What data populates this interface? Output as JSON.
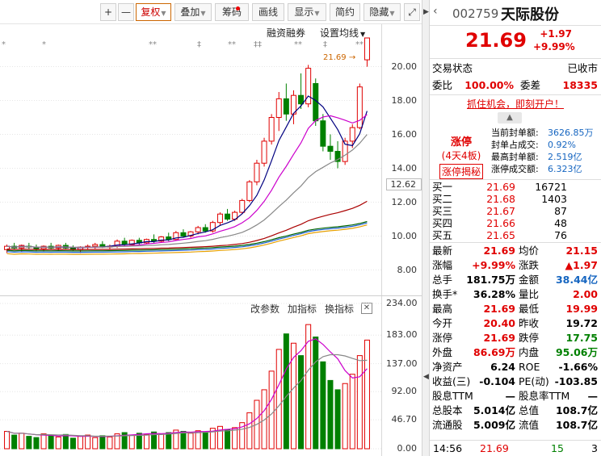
{
  "toolbar": {
    "buttons": [
      {
        "label": "+"
      },
      {
        "label": "—"
      },
      {
        "label": "复权",
        "dropdown": true,
        "active": true
      },
      {
        "label": "叠加",
        "dropdown": true
      },
      {
        "label": "筹码",
        "badge": true
      },
      {
        "label": "画线"
      },
      {
        "label": "显示",
        "dropdown": true
      },
      {
        "label": "简约"
      },
      {
        "label": "隐藏",
        "dropdown": true
      }
    ],
    "expand_icon": "expand-icon"
  },
  "price_panel": {
    "margin_label": "融资融券",
    "ma_label": "设置均线",
    "last_price_tag": "21.69",
    "current_axis_label": "12.62",
    "axis_labels": [
      "20.00",
      "18.00",
      "16.00",
      "14.00",
      "12.00",
      "10.00",
      "8.00"
    ],
    "markers": [
      "*",
      "*",
      "**",
      "‡",
      "**",
      "‡‡",
      "**",
      "‡",
      "**",
      "‡"
    ]
  },
  "volume_panel": {
    "labels": [
      "改参数",
      "加指标",
      "换指标"
    ],
    "close": "✕",
    "axis_labels": [
      "234.00",
      "183.00",
      "137.00",
      "92.00",
      "46.70",
      "0.00"
    ]
  },
  "quote": {
    "code": "002759",
    "name": "天际股份",
    "price": "21.69",
    "change": "+1.97",
    "change_pct": "+9.99%",
    "trade_status_label": "交易状态",
    "trade_status": "已收市",
    "weibi_label": "委比",
    "weibi": "100.00%",
    "weicha_label": "委差",
    "weicha": "18335",
    "promo": "抓住机会，即刻开户！",
    "limit": {
      "title": "涨停",
      "streak": "(4天4板)",
      "button": "涨停揭秘"
    },
    "seal": [
      {
        "label": "当前封单额:",
        "value": "3626.85万"
      },
      {
        "label": "封单占成交:",
        "value": "0.92%"
      },
      {
        "label": "最高封单额:",
        "value": "2.519亿"
      },
      {
        "label": "涨停成交额:",
        "value": "6.323亿"
      }
    ],
    "bids": [
      {
        "label": "买一",
        "price": "21.69",
        "vol": "16721"
      },
      {
        "label": "买二",
        "price": "21.68",
        "vol": "1403"
      },
      {
        "label": "买三",
        "price": "21.67",
        "vol": "87"
      },
      {
        "label": "买四",
        "price": "21.66",
        "vol": "48"
      },
      {
        "label": "买五",
        "price": "21.65",
        "vol": "76"
      }
    ],
    "stats": [
      {
        "l1": "最新",
        "v1": "21.69",
        "c1": "red",
        "l2": "均价",
        "v2": "21.15",
        "c2": "red"
      },
      {
        "l1": "涨幅",
        "v1": "+9.99%",
        "c1": "red",
        "l2": "涨跌",
        "v2": "▲1.97",
        "c2": "red"
      },
      {
        "l1": "总手",
        "v1": "181.75万",
        "c1": "blk",
        "l2": "金额",
        "v2": "38.44亿",
        "c2": "blue"
      },
      {
        "l1": "换手*",
        "v1": "36.28%",
        "c1": "blk",
        "l2": "量比",
        "v2": "2.00",
        "c2": "red"
      },
      {
        "l1": "最高",
        "v1": "21.69",
        "c1": "red",
        "l2": "最低",
        "v2": "19.99",
        "c2": "red"
      },
      {
        "l1": "今开",
        "v1": "20.40",
        "c1": "red",
        "l2": "昨收",
        "v2": "19.72",
        "c2": "blk"
      },
      {
        "l1": "涨停",
        "v1": "21.69",
        "c1": "red",
        "l2": "跌停",
        "v2": "17.75",
        "c2": "green"
      },
      {
        "l1": "外盘",
        "v1": "86.69万",
        "c1": "red",
        "l2": "内盘",
        "v2": "95.06万",
        "c2": "green"
      },
      {
        "l1": "净资产",
        "v1": "6.24",
        "c1": "blk",
        "l2": "ROE",
        "v2": "-1.66%",
        "c2": "blk"
      },
      {
        "l1": "收益(三)",
        "v1": "-0.104",
        "c1": "blk",
        "l2": "PE(动)",
        "v2": "-103.85",
        "c2": "blk"
      },
      {
        "l1": "股息TTM",
        "v1": "—",
        "c1": "blk",
        "l2": "股息率TTM",
        "v2": "—",
        "c2": "blk"
      },
      {
        "l1": "总股本",
        "v1": "5.014亿",
        "c1": "blk",
        "l2": "总值",
        "v2": "108.7亿",
        "c2": "blk"
      },
      {
        "l1": "流通股",
        "v1": "5.009亿",
        "c1": "blk",
        "l2": "流值",
        "v2": "108.7亿",
        "c2": "blk"
      }
    ],
    "footer": {
      "time": "14:56",
      "price": "21.69",
      "vol": "15",
      "count": "3"
    }
  },
  "chart_data": [
    {
      "type": "candlestick",
      "yticks": [
        8,
        10,
        12,
        14,
        16,
        18,
        20
      ],
      "ylim": [
        6.5,
        22.5
      ],
      "candles": [
        {
          "o": 9.2,
          "h": 9.5,
          "l": 9.0,
          "c": 9.4
        },
        {
          "o": 9.4,
          "h": 9.6,
          "l": 9.2,
          "c": 9.3
        },
        {
          "o": 9.3,
          "h": 9.5,
          "l": 9.1,
          "c": 9.45
        },
        {
          "o": 9.4,
          "h": 9.6,
          "l": 9.2,
          "c": 9.35
        },
        {
          "o": 9.35,
          "h": 9.5,
          "l": 9.1,
          "c": 9.25
        },
        {
          "o": 9.25,
          "h": 9.45,
          "l": 9.1,
          "c": 9.4
        },
        {
          "o": 9.4,
          "h": 9.6,
          "l": 9.2,
          "c": 9.3
        },
        {
          "o": 9.3,
          "h": 9.5,
          "l": 9.15,
          "c": 9.45
        },
        {
          "o": 9.45,
          "h": 9.6,
          "l": 9.2,
          "c": 9.3
        },
        {
          "o": 9.3,
          "h": 9.45,
          "l": 9.1,
          "c": 9.2
        },
        {
          "o": 9.2,
          "h": 9.4,
          "l": 9.0,
          "c": 9.35
        },
        {
          "o": 9.35,
          "h": 9.5,
          "l": 9.2,
          "c": 9.4
        },
        {
          "o": 9.4,
          "h": 9.6,
          "l": 9.25,
          "c": 9.5
        },
        {
          "o": 9.5,
          "h": 9.7,
          "l": 9.3,
          "c": 9.35
        },
        {
          "o": 9.35,
          "h": 9.5,
          "l": 9.2,
          "c": 9.4
        },
        {
          "o": 9.4,
          "h": 9.8,
          "l": 9.3,
          "c": 9.7
        },
        {
          "o": 9.7,
          "h": 9.9,
          "l": 9.4,
          "c": 9.5
        },
        {
          "o": 9.5,
          "h": 9.8,
          "l": 9.4,
          "c": 9.75
        },
        {
          "o": 9.75,
          "h": 9.9,
          "l": 9.5,
          "c": 9.6
        },
        {
          "o": 9.6,
          "h": 9.85,
          "l": 9.5,
          "c": 9.8
        },
        {
          "o": 9.8,
          "h": 10.1,
          "l": 9.6,
          "c": 9.7
        },
        {
          "o": 9.7,
          "h": 10.0,
          "l": 9.6,
          "c": 9.95
        },
        {
          "o": 9.95,
          "h": 10.2,
          "l": 9.7,
          "c": 9.8
        },
        {
          "o": 9.8,
          "h": 10.3,
          "l": 9.75,
          "c": 10.2
        },
        {
          "o": 10.2,
          "h": 10.4,
          "l": 9.9,
          "c": 10.0
        },
        {
          "o": 10.0,
          "h": 10.3,
          "l": 9.9,
          "c": 10.25
        },
        {
          "o": 10.25,
          "h": 10.6,
          "l": 10.1,
          "c": 10.5
        },
        {
          "o": 10.5,
          "h": 10.7,
          "l": 10.2,
          "c": 10.3
        },
        {
          "o": 10.3,
          "h": 10.9,
          "l": 10.2,
          "c": 10.8
        },
        {
          "o": 10.8,
          "h": 11.4,
          "l": 10.6,
          "c": 11.3
        },
        {
          "o": 11.3,
          "h": 11.6,
          "l": 10.9,
          "c": 11.0
        },
        {
          "o": 11.0,
          "h": 11.5,
          "l": 10.9,
          "c": 11.4
        },
        {
          "o": 11.4,
          "h": 12.2,
          "l": 11.3,
          "c": 12.1
        },
        {
          "o": 12.1,
          "h": 13.3,
          "l": 12.0,
          "c": 13.2
        },
        {
          "o": 13.2,
          "h": 14.5,
          "l": 13.0,
          "c": 14.3
        },
        {
          "o": 14.3,
          "h": 15.8,
          "l": 14.1,
          "c": 15.6
        },
        {
          "o": 15.6,
          "h": 17.2,
          "l": 15.4,
          "c": 17.0
        },
        {
          "o": 17.0,
          "h": 18.5,
          "l": 16.2,
          "c": 18.1
        },
        {
          "o": 18.1,
          "h": 19.0,
          "l": 16.8,
          "c": 17.2
        },
        {
          "o": 17.2,
          "h": 18.6,
          "l": 16.6,
          "c": 18.3
        },
        {
          "o": 18.3,
          "h": 19.6,
          "l": 17.5,
          "c": 17.8
        },
        {
          "o": 17.8,
          "h": 20.1,
          "l": 17.6,
          "c": 19.9
        },
        {
          "o": 19.0,
          "h": 19.3,
          "l": 16.5,
          "c": 16.8
        },
        {
          "o": 16.8,
          "h": 17.2,
          "l": 15.0,
          "c": 15.3
        },
        {
          "o": 15.3,
          "h": 16.0,
          "l": 14.5,
          "c": 15.0
        },
        {
          "o": 15.0,
          "h": 15.6,
          "l": 14.0,
          "c": 14.4
        },
        {
          "o": 14.4,
          "h": 15.8,
          "l": 14.2,
          "c": 15.6
        },
        {
          "o": 15.6,
          "h": 16.6,
          "l": 15.2,
          "c": 16.4
        },
        {
          "o": 16.4,
          "h": 19.0,
          "l": 16.3,
          "c": 18.8
        },
        {
          "o": 20.4,
          "h": 21.69,
          "l": 19.99,
          "c": 21.69
        }
      ]
    },
    {
      "type": "bar",
      "yticks": [
        0,
        46.7,
        92,
        137,
        183,
        234
      ],
      "ylim": [
        0,
        234
      ],
      "values": [
        28,
        22,
        25,
        20,
        18,
        24,
        21,
        19,
        23,
        17,
        20,
        22,
        18,
        21,
        19,
        24,
        26,
        22,
        25,
        23,
        27,
        24,
        26,
        30,
        28,
        25,
        29,
        27,
        33,
        36,
        31,
        34,
        42,
        58,
        78,
        95,
        125,
        160,
        185,
        170,
        150,
        200,
        180,
        140,
        110,
        95,
        105,
        120,
        150,
        175
      ]
    }
  ]
}
